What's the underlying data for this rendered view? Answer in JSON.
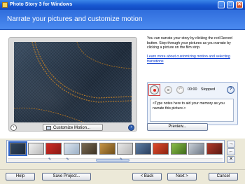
{
  "window": {
    "title": "Photo Story 3 for Windows",
    "minimize": "_",
    "maximize": "□",
    "close": "✕"
  },
  "header": {
    "title": "Narrate your pictures and customize motion"
  },
  "preview": {
    "customize_label": "Customize Motion...",
    "prev_arrow": "‹",
    "next_arrow": "›"
  },
  "info": {
    "instructions": "You can narrate your story by clicking the red Record button. Step through your pictures as you narrate by clicking a picture on the film strip.",
    "learn_link": "Learn more about customizing motion and selecting transitions"
  },
  "narration": {
    "timer": "00:00",
    "status": "Stopped",
    "undo_glyph": "↶",
    "help_glyph": "?",
    "notes_placeholder": "<Type notes here to aid your memory as you narrate this picture.>"
  },
  "preview_button": "Preview...",
  "filmstrip": {
    "thumbs": [
      {
        "colors": [
          "#33475e",
          "#1d2a3a"
        ],
        "selected": true
      },
      {
        "colors": [
          "#f2f2f2",
          "#b9b9b9"
        ]
      },
      {
        "colors": [
          "#d12b24",
          "#8a1a15"
        ],
        "edited": true
      },
      {
        "colors": [
          "#dfe7f0",
          "#9cb0c6"
        ],
        "edited": true
      },
      {
        "colors": [
          "#7a6a52",
          "#3d3325"
        ]
      },
      {
        "colors": [
          "#c69445",
          "#6f4e1a"
        ]
      },
      {
        "colors": [
          "#e9e9e9",
          "#b5b5b5"
        ],
        "edited": true
      },
      {
        "colors": [
          "#5f7fa5",
          "#2a3f5e"
        ]
      },
      {
        "colors": [
          "#e14a2a",
          "#8c2412"
        ]
      },
      {
        "colors": [
          "#8cc04a",
          "#3f6a1a"
        ]
      },
      {
        "colors": [
          "#c9d0d8",
          "#6f7986"
        ]
      },
      {
        "colors": [
          "#b33a2a",
          "#5b1a12"
        ]
      }
    ],
    "edit_glyph": "✎"
  },
  "side_buttons": {
    "right": "→",
    "left": "←",
    "delete": "✕"
  },
  "buttons": {
    "help": "Help",
    "save_project": "Save Project...",
    "back": "< Back",
    "next": "Next >",
    "cancel": "Cancel"
  }
}
